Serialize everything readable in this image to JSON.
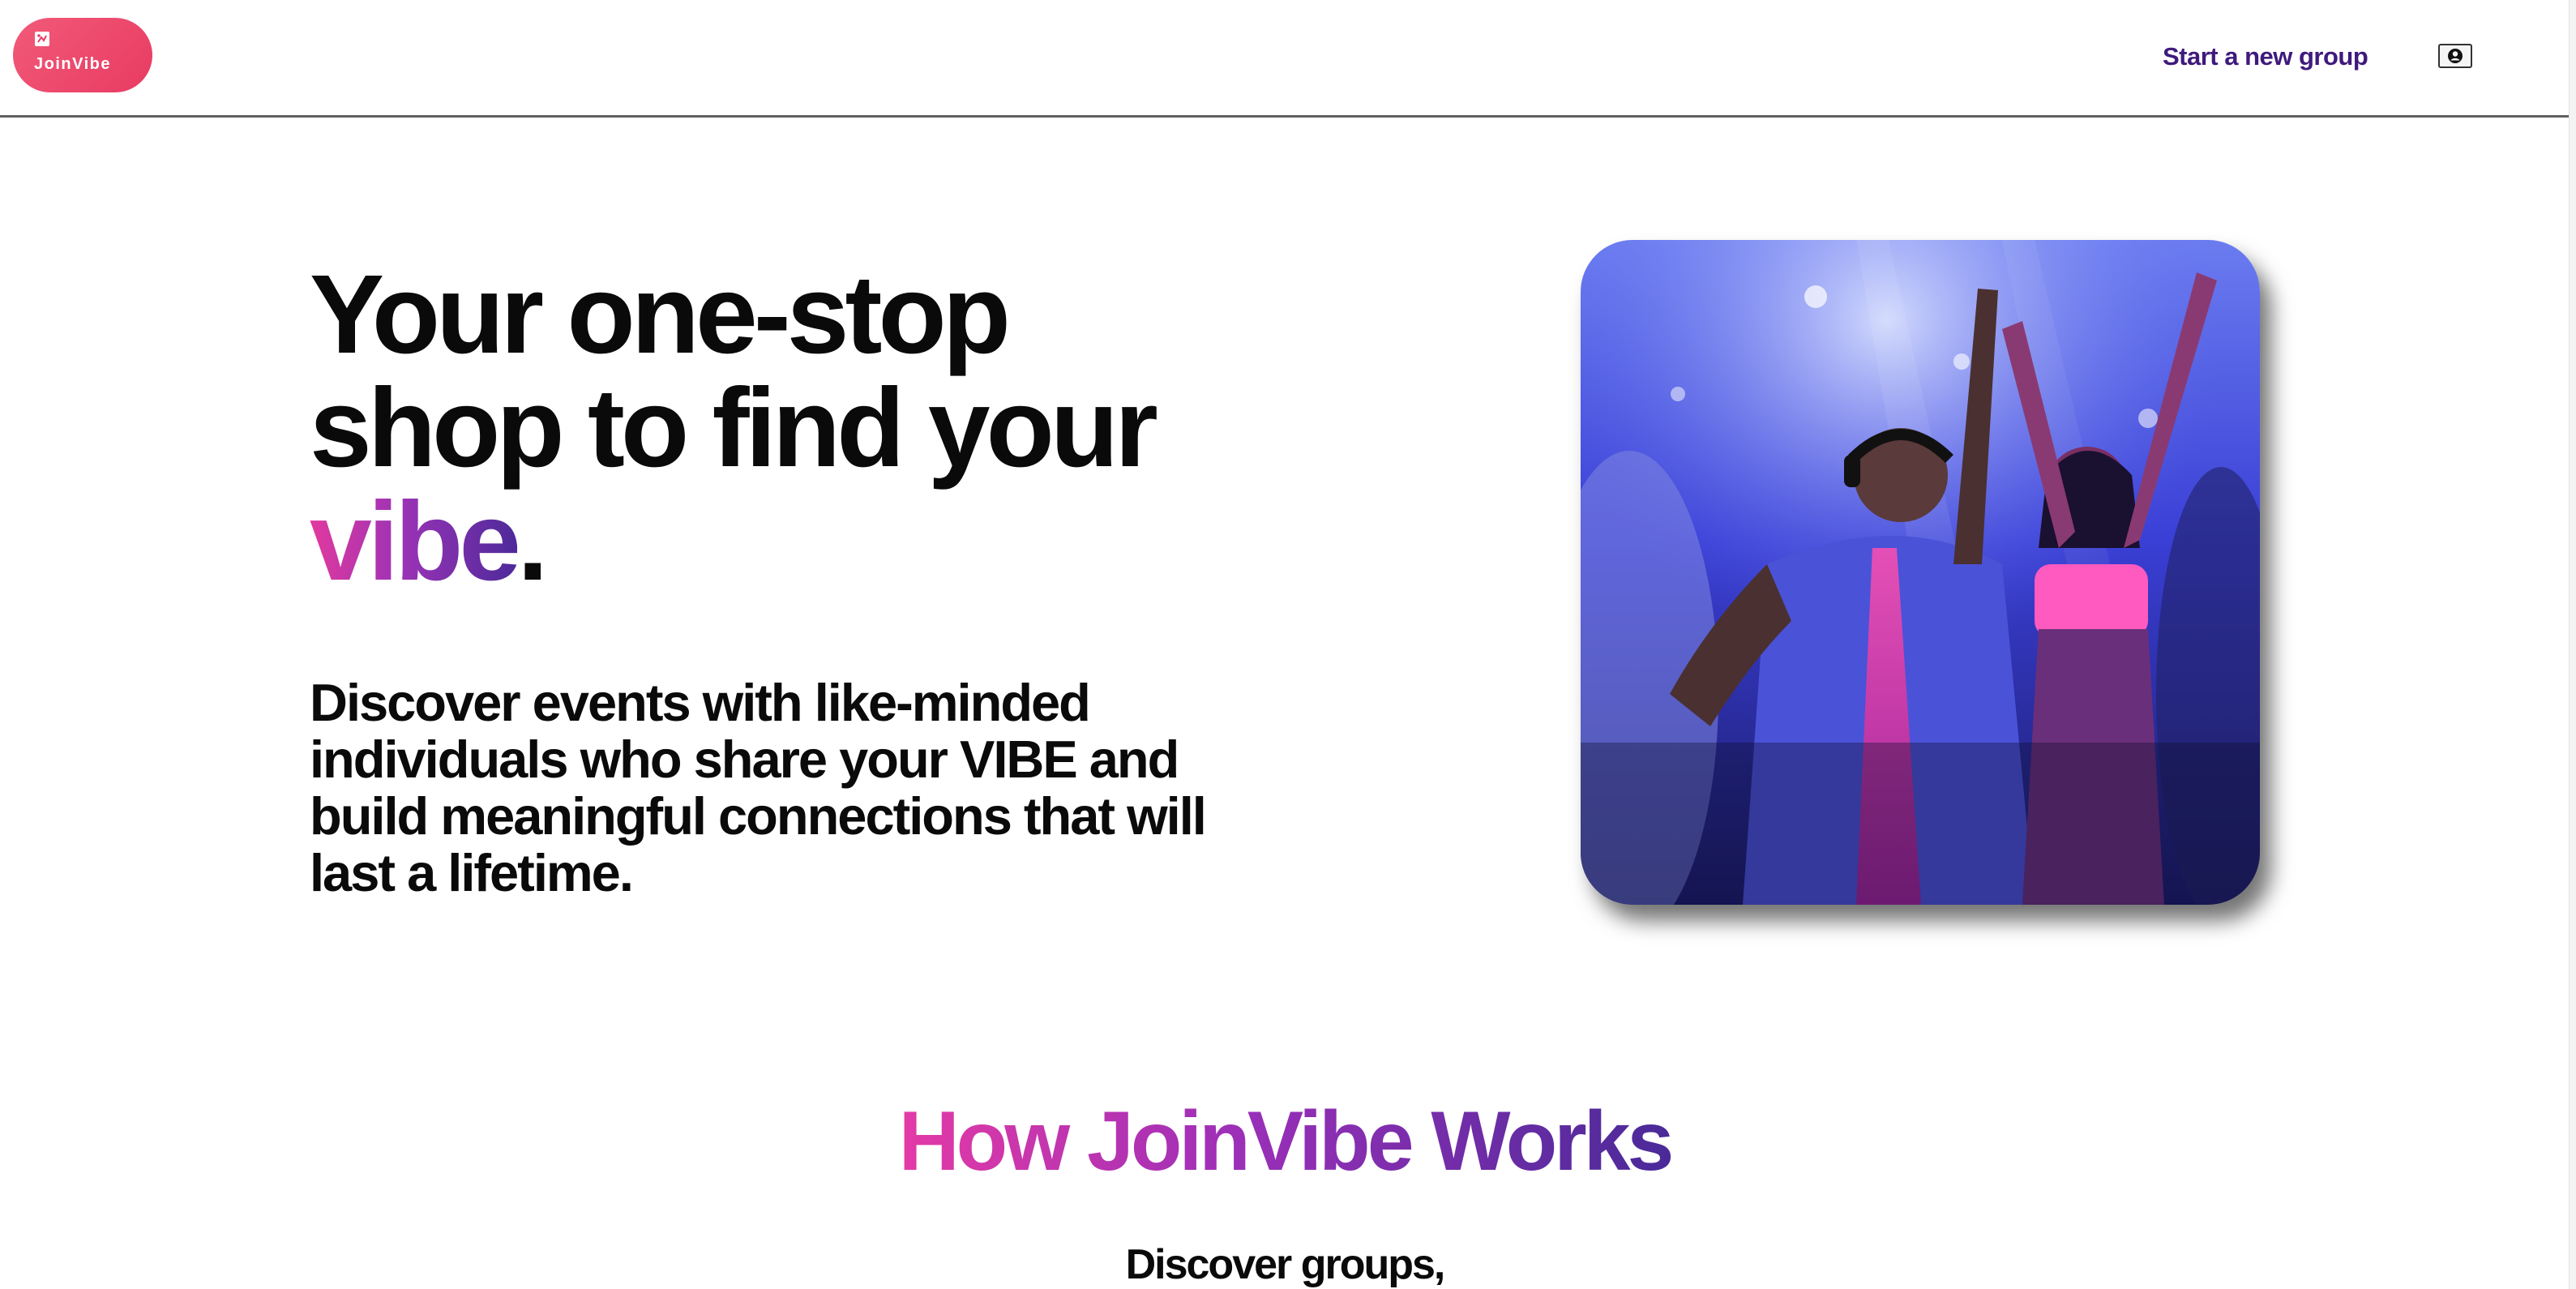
{
  "header": {
    "logo_text": "JoinVibe",
    "start_group_label": "Start a new group",
    "profile_icon": "user-circle-icon"
  },
  "hero": {
    "title_line1": "Your one-stop",
    "title_line2": "shop to find your",
    "title_accent": "vibe",
    "title_period": ".",
    "subtitle": "Discover events with like-minded individuals who share your VIBE and build meaningful connections that will last a lifetime.",
    "image_subject": "people dancing at a concert under blue and pink lights"
  },
  "how_it_works": {
    "title": "How JoinVibe Works",
    "first_step_heading": "Discover groups,"
  },
  "colors": {
    "logo_background": "#ee4d6f",
    "link_purple": "#3f1a7c",
    "gradient_pink": "#e2399e",
    "gradient_purple": "#4e2a9a"
  }
}
